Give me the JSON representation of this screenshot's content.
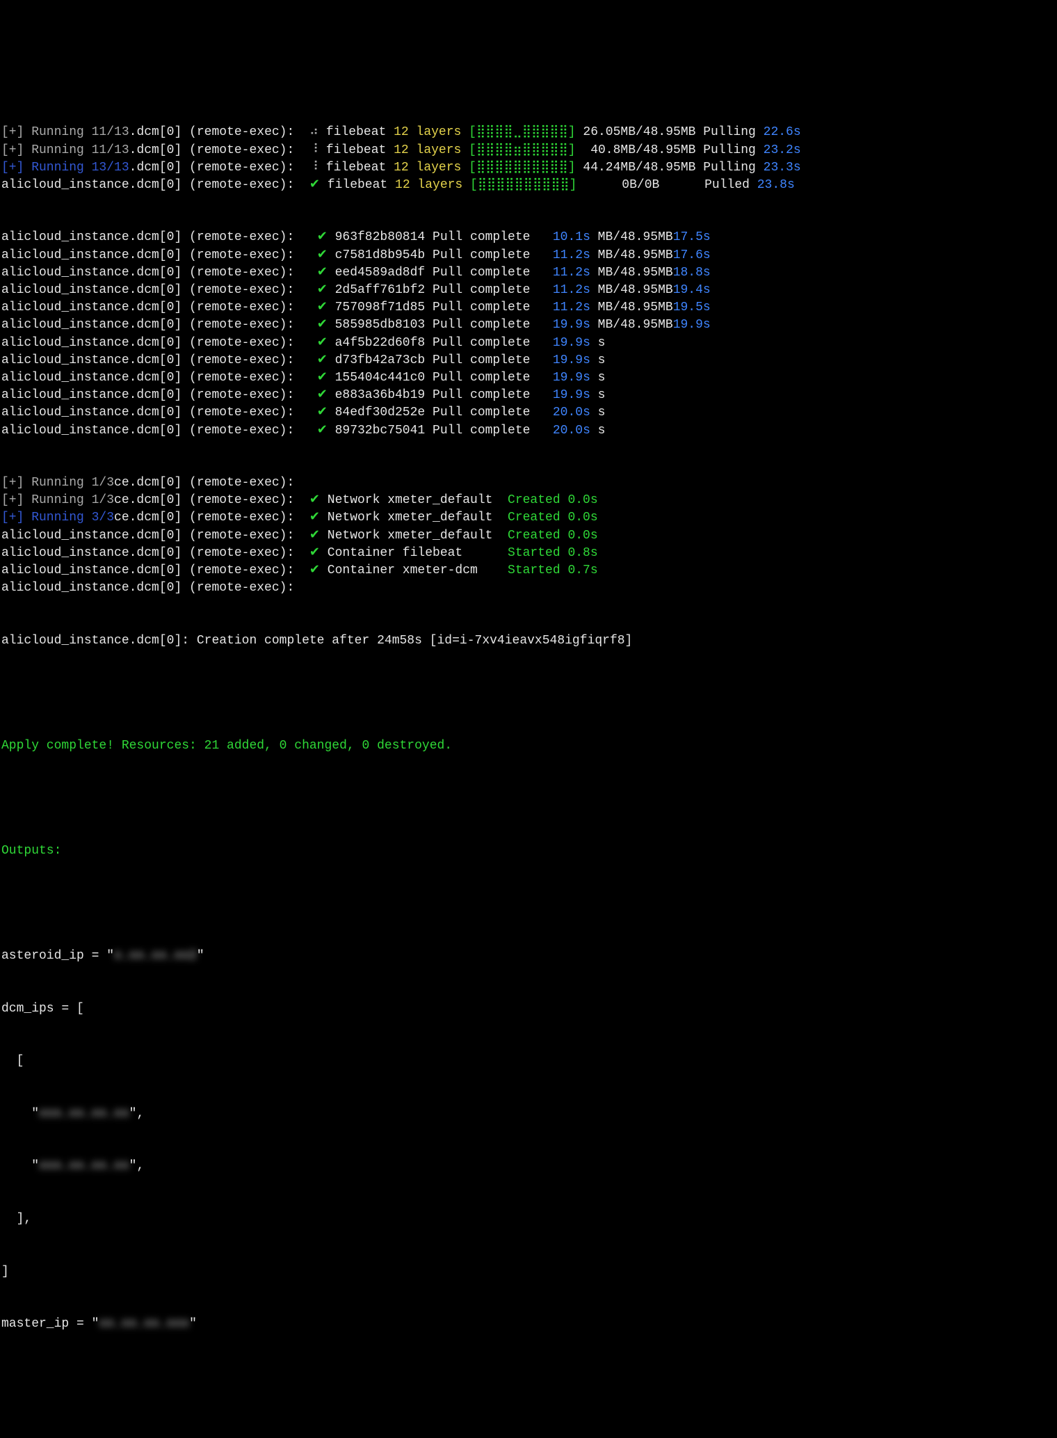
{
  "filebeat": [
    {
      "prefix_a": "[+] Running 11/13",
      "prefix_b": ".dcm[0] (remote-exec):",
      "spinner": "⠴",
      "name": " filebeat ",
      "num": "12",
      "word": " layers ",
      "bar": "[⣿⣿⣿⣿⣀⣿⣿⣿⣿⣿]",
      "size": " 26.05MB/48.95MB Pulling ",
      "time": "22.6s",
      "prefix_blue": false
    },
    {
      "prefix_a": "[+] Running 11/13",
      "prefix_b": ".dcm[0] (remote-exec):",
      "spinner": "⠸",
      "name": " filebeat ",
      "num": "12",
      "word": " layers ",
      "bar": "[⣿⣿⣿⣿⣶⣿⣿⣿⣿⣿]",
      "size": "  40.8MB/48.95MB Pulling ",
      "time": "23.2s",
      "prefix_blue": false
    },
    {
      "prefix_a": "[+] Running 13/13",
      "prefix_b": ".dcm[0] (remote-exec):",
      "spinner": "⠸",
      "name": " filebeat ",
      "num": "12",
      "word": " layers ",
      "bar": "[⣿⣿⣿⣿⣿⣿⣿⣿⣿⣿]",
      "size": " 44.24MB/48.95MB Pulling ",
      "time": "23.3s",
      "prefix_blue": true
    },
    {
      "prefix_a": "alicloud_instance.dcm[0] (remote-exec):",
      "spinner": "✔",
      "name": " filebeat ",
      "num": "12",
      "word": " layers ",
      "bar": "[⣿⣿⣿⣿⣿⣿⣿⣿⣿⣿]",
      "size": "      0B/0B      Pulled ",
      "time": "23.8s"
    }
  ],
  "pulls": [
    {
      "prefix": "alicloud_instance.dcm[0] (remote-exec):",
      "hash": "963f82b80814",
      "msg": "Pull complete",
      "time": "10.1s",
      "tail": " MB/48.95MB",
      "tail2": "17.5s"
    },
    {
      "prefix": "alicloud_instance.dcm[0] (remote-exec):",
      "hash": "c7581d8b954b",
      "msg": "Pull complete",
      "time": "11.2s",
      "tail": " MB/48.95MB",
      "tail2": "17.6s"
    },
    {
      "prefix": "alicloud_instance.dcm[0] (remote-exec):",
      "hash": "eed4589ad8df",
      "msg": "Pull complete",
      "time": "11.2s",
      "tail": " MB/48.95MB",
      "tail2": "18.8s"
    },
    {
      "prefix": "alicloud_instance.dcm[0] (remote-exec):",
      "hash": "2d5aff761bf2",
      "msg": "Pull complete",
      "time": "11.2s",
      "tail": " MB/48.95MB",
      "tail2": "19.4s"
    },
    {
      "prefix": "alicloud_instance.dcm[0] (remote-exec):",
      "hash": "757098f71d85",
      "msg": "Pull complete",
      "time": "11.2s",
      "tail": " MB/48.95MB",
      "tail2": "19.5s"
    },
    {
      "prefix": "alicloud_instance.dcm[0] (remote-exec):",
      "hash": "585985db8103",
      "msg": "Pull complete",
      "time": "19.9s",
      "tail": " MB/48.95MB",
      "tail2": "19.9s"
    },
    {
      "prefix": "alicloud_instance.dcm[0] (remote-exec):",
      "hash": "a4f5b22d60f8",
      "msg": "Pull complete",
      "time": "19.9s",
      "tail": " s",
      "tail2": ""
    },
    {
      "prefix": "alicloud_instance.dcm[0] (remote-exec):",
      "hash": "d73fb42a73cb",
      "msg": "Pull complete",
      "time": "19.9s",
      "tail": " s",
      "tail2": ""
    },
    {
      "prefix": "alicloud_instance.dcm[0] (remote-exec):",
      "hash": "155404c441c0",
      "msg": "Pull complete",
      "time": "19.9s",
      "tail": " s",
      "tail2": ""
    },
    {
      "prefix": "alicloud_instance.dcm[0] (remote-exec):",
      "hash": "e883a36b4b19",
      "msg": "Pull complete",
      "time": "19.9s",
      "tail": " s",
      "tail2": ""
    },
    {
      "prefix": "alicloud_instance.dcm[0] (remote-exec):",
      "hash": "84edf30d252e",
      "msg": "Pull complete",
      "time": "20.0s",
      "tail": " s",
      "tail2": ""
    },
    {
      "prefix": "alicloud_instance.dcm[0] (remote-exec):",
      "hash": "89732bc75041",
      "msg": "Pull complete",
      "time": "20.0s",
      "tail": " s",
      "tail2": ""
    }
  ],
  "net": [
    {
      "prefix_a": "[+] Running 1/3",
      "prefix_b": "ce.dcm[0] (remote-exec):",
      "content": "",
      "prefix_blue": false
    },
    {
      "prefix_a": "[+] Running 1/3",
      "prefix_b": "ce.dcm[0] (remote-exec):",
      "content": "net",
      "prefix_blue": false
    },
    {
      "prefix_a": "[+] Running 3/3",
      "prefix_b": "ce.dcm[0] (remote-exec):",
      "content": "net",
      "prefix_blue": true
    },
    {
      "prefix_a": "alicloud_instance.dcm[0] (remote-exec):",
      "content": "net"
    },
    {
      "prefix_a": "alicloud_instance.dcm[0] (remote-exec):",
      "content": "c_fb"
    },
    {
      "prefix_a": "alicloud_instance.dcm[0] (remote-exec):",
      "content": "c_dcm"
    },
    {
      "prefix_a": "alicloud_instance.dcm[0] (remote-exec):",
      "content": ""
    }
  ],
  "netcontent": {
    "net": {
      "check": "✔",
      "body": " Network xmeter_default  ",
      "status": "Created 0.0s"
    },
    "c_fb": {
      "check": "✔",
      "body": " Container filebeat      ",
      "status": "Started 0.8s"
    },
    "c_dcm": {
      "check": "✔",
      "body": " Container xmeter-dcm    ",
      "status": "Started 0.7s"
    }
  },
  "creation": "alicloud_instance.dcm[0]: Creation complete after 24m58s [id=i-7xv4ieavx548igfiqrf8]",
  "apply": "Apply complete! Resources: 21 added, 0 changed, 0 destroyed.",
  "outputs_label": "Outputs:",
  "outputs": {
    "l1a": "asteroid_ip = \"",
    "l1b": "x.xx.xx.xx2",
    "l1c": "\"",
    "l2": "dcm_ips = [",
    "l3": "  [",
    "l4a": "    \"",
    "l4b": "xxx.xx.xx.xx",
    "l4c": "\",",
    "l5a": "    \"",
    "l5b": "xxx.xx.xx.xx",
    "l5c": "\",",
    "l6": "  ],",
    "l7": "]",
    "l8a": "master_ip = \"",
    "l8b": "xx.xx.xx.xxx",
    "l8c": "\""
  }
}
